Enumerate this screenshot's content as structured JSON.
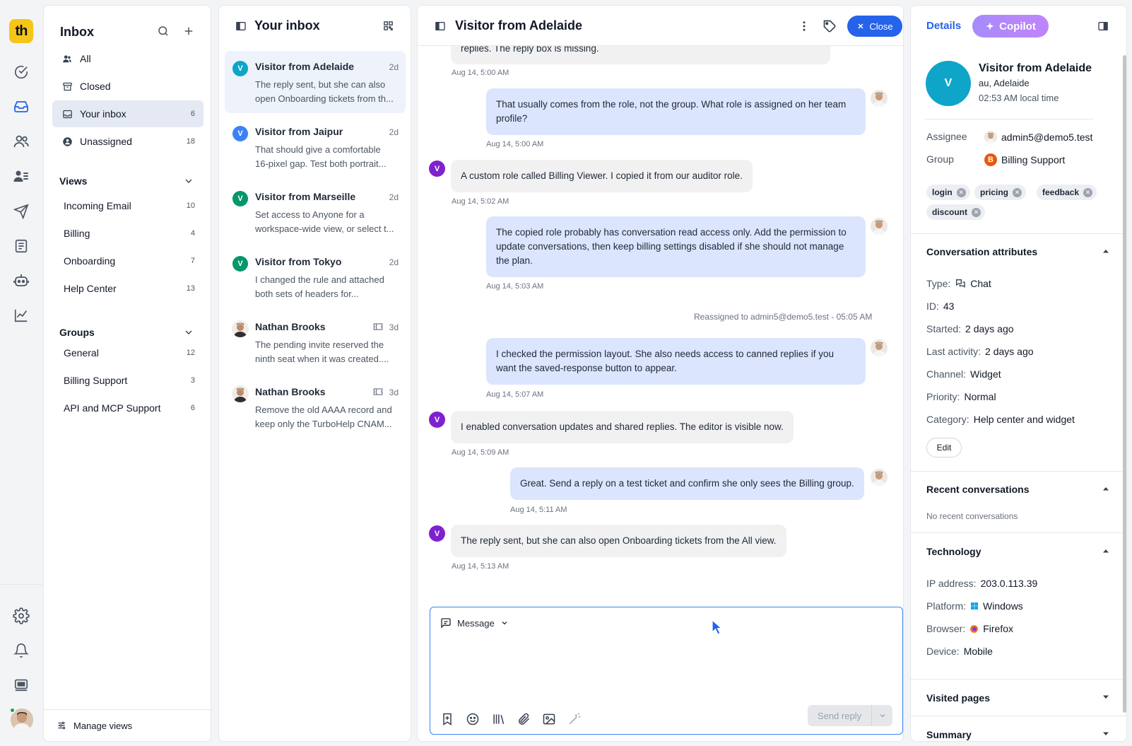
{
  "app": {
    "logo_text": "th"
  },
  "rail": {
    "items": [
      "check-circle-icon",
      "inbox-icon",
      "contacts-icon",
      "team-icon",
      "send-icon",
      "articles-icon",
      "bot-icon",
      "reports-icon"
    ],
    "bottom": [
      "settings-icon",
      "bell-icon",
      "billing-icon"
    ]
  },
  "sidebar": {
    "title": "Inbox",
    "items": [
      {
        "label": "All",
        "count": ""
      },
      {
        "label": "Closed",
        "count": ""
      },
      {
        "label": "Your inbox",
        "count": "6"
      },
      {
        "label": "Unassigned",
        "count": "18"
      }
    ],
    "views_title": "Views",
    "views": [
      {
        "label": "Incoming Email",
        "count": "10"
      },
      {
        "label": "Billing",
        "count": "4"
      },
      {
        "label": "Onboarding",
        "count": "7"
      },
      {
        "label": "Help Center",
        "count": "13"
      }
    ],
    "groups_title": "Groups",
    "groups": [
      {
        "label": "General",
        "count": "12"
      },
      {
        "label": "Billing Support",
        "count": "3"
      },
      {
        "label": "API and MCP Support",
        "count": "6"
      }
    ],
    "footer": "Manage views"
  },
  "list": {
    "title": "Your inbox",
    "conversations": [
      {
        "initial": "V",
        "name": "Visitor from Adelaide",
        "time": "2d",
        "preview": "The reply sent, but she can also open Onboarding tickets from th...",
        "color": "#0ea5c8"
      },
      {
        "initial": "V",
        "name": "Visitor from Jaipur",
        "time": "2d",
        "preview": "That should give a comfortable 16-pixel gap. Test both portrait...",
        "color": "#3b82f6"
      },
      {
        "initial": "V",
        "name": "Visitor from Marseille",
        "time": "2d",
        "preview": "Set access to Anyone for a workspace-wide view, or select t...",
        "color": "#059669"
      },
      {
        "initial": "V",
        "name": "Visitor from Tokyo",
        "time": "2d",
        "preview": "I changed the rule and attached both sets of headers for...",
        "color": "#059669"
      },
      {
        "initial": "",
        "name": "Nathan Brooks",
        "time": "3d",
        "preview": "The pending invite reserved the ninth seat when it was created....",
        "color": ""
      },
      {
        "initial": "",
        "name": "Nathan Brooks",
        "time": "3d",
        "preview": "Remove the old AAAA record and keep only the TurboHelp CNAM...",
        "color": ""
      }
    ]
  },
  "chat": {
    "title": "Visitor from Adelaide",
    "close_label": "Close",
    "messages": [
      {
        "text": "replies. The reply box is missing.",
        "time": "Aug 14, 5:00 AM"
      },
      {
        "text": "That usually comes from the role, not the group. What role is assigned on her team profile?",
        "time": "Aug 14, 5:00 AM"
      },
      {
        "text": "A custom role called Billing Viewer. I copied it from our auditor role.",
        "time": "Aug 14, 5:02 AM"
      },
      {
        "text": "The copied role probably has conversation read access only. Add the permission to update conversations, then keep billing settings disabled if she should not manage the plan.",
        "time": "Aug 14, 5:03 AM"
      },
      {
        "text": "I checked the permission layout. She also needs access to canned replies if you want the saved-response button to appear.",
        "time": "Aug 14, 5:07 AM"
      },
      {
        "text": "I enabled conversation updates and shared replies. The editor is visible now.",
        "time": "Aug 14, 5:09 AM"
      },
      {
        "text": "Great. Send a reply on a test ticket and confirm she only sees the Billing group.",
        "time": "Aug 14, 5:11 AM"
      },
      {
        "text": "The reply sent, but she can also open Onboarding tickets from the All view.",
        "time": "Aug 14, 5:13 AM"
      }
    ],
    "system_note": "Reassigned to admin5@demo5.test - 05:05 AM",
    "visitor_initial": "V",
    "composer": {
      "mode": "Message",
      "send_label": "Send reply"
    }
  },
  "details": {
    "tab_details": "Details",
    "tab_copilot": "Copilot",
    "visitor": {
      "initial": "V",
      "name": "Visitor from Adelaide",
      "location": "au, Adelaide",
      "local_time": "02:53 AM local time"
    },
    "assignee_label": "Assignee",
    "assignee": "admin5@demo5.test",
    "group_label": "Group",
    "group": "Billing Support",
    "group_initial": "B",
    "tags": [
      "login",
      "pricing",
      "feedback",
      "discount"
    ],
    "attributes_title": "Conversation attributes",
    "attributes": [
      {
        "k": "Type:",
        "v": "Chat"
      },
      {
        "k": "ID:",
        "v": "43"
      },
      {
        "k": "Started:",
        "v": "2 days ago"
      },
      {
        "k": "Last activity:",
        "v": "2 days ago"
      },
      {
        "k": "Channel:",
        "v": "Widget"
      },
      {
        "k": "Priority:",
        "v": "Normal"
      },
      {
        "k": "Category:",
        "v": "Help center and widget"
      }
    ],
    "edit_label": "Edit",
    "recent_title": "Recent conversations",
    "recent_empty": "No recent conversations",
    "tech_title": "Technology",
    "tech": [
      {
        "k": "IP address:",
        "v": "203.0.113.39"
      },
      {
        "k": "Platform:",
        "v": "Windows"
      },
      {
        "k": "Browser:",
        "v": "Firefox"
      },
      {
        "k": "Device:",
        "v": "Mobile"
      }
    ],
    "visited_title": "Visited pages",
    "summary_title": "Summary"
  }
}
